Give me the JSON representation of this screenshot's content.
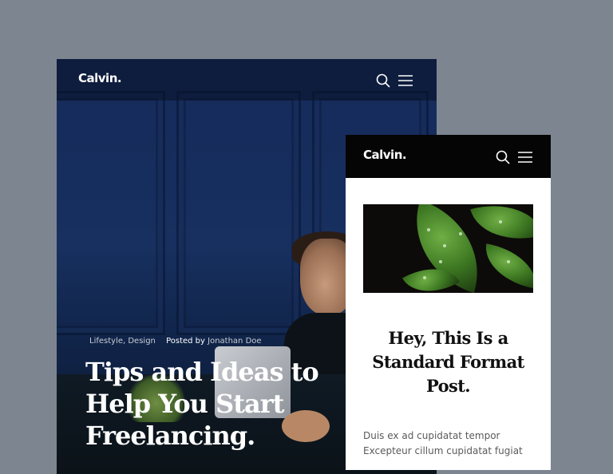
{
  "desktop_card": {
    "logo": "Calvin.",
    "icons": {
      "search": "search-icon",
      "menu": "hamburger-menu-icon"
    },
    "categories": "Lifestyle, Design",
    "posted_by_label": "Posted by",
    "author": "Jonathan Doe",
    "title": "Tips and Ideas to Help You Start Freelancing."
  },
  "mobile_card": {
    "logo": "Calvin.",
    "icons": {
      "search": "search-icon",
      "menu": "hamburger-menu-icon"
    },
    "title": "Hey, This Is a Standard Format Post.",
    "excerpt_line1": "Duis ex ad cupidatat tempor",
    "excerpt_line2": "Excepteur cillum cupidatat fugiat"
  },
  "colors": {
    "page_background": "#7d8590",
    "header_dark": "#050505",
    "hero_blue": "#17305f",
    "text_white": "#ffffff",
    "title_dark": "#111111"
  }
}
